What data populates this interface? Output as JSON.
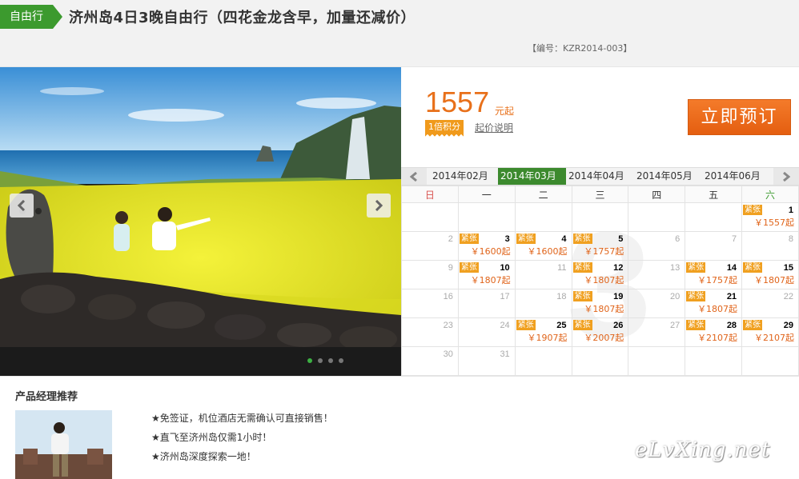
{
  "header": {
    "tag": "自由行",
    "title": "济州岛4日3晚自由行（四花金龙含早，加量还减价）",
    "code": "【编号：KZR2014-003】"
  },
  "gallery": {
    "slides": 4,
    "active_slide": 1
  },
  "pricing": {
    "price": "1557",
    "unit": "元起",
    "points_badge": "1倍积分",
    "points_link": "起价说明",
    "book_button": "立即预订"
  },
  "calendar": {
    "months": [
      "2014年02月",
      "2014年03月",
      "2014年04月",
      "2014年05月",
      "2014年06月"
    ],
    "active_month": 1,
    "weekdays": [
      "日",
      "一",
      "二",
      "三",
      "四",
      "五",
      "六"
    ],
    "weeks": [
      [
        null,
        null,
        null,
        null,
        null,
        null,
        {
          "d": "1",
          "hot": "紧张",
          "p": "￥1557起"
        }
      ],
      [
        {
          "d": "2"
        },
        {
          "d": "3",
          "hot": "紧张",
          "p": "￥1600起"
        },
        {
          "d": "4",
          "hot": "紧张",
          "p": "￥1600起"
        },
        {
          "d": "5",
          "hot": "紧张",
          "p": "￥1757起"
        },
        {
          "d": "6"
        },
        {
          "d": "7"
        },
        {
          "d": "8"
        }
      ],
      [
        {
          "d": "9"
        },
        {
          "d": "10",
          "hot": "紧张",
          "p": "￥1807起"
        },
        {
          "d": "11"
        },
        {
          "d": "12",
          "hot": "紧张",
          "p": "￥1807起"
        },
        {
          "d": "13"
        },
        {
          "d": "14",
          "hot": "紧张",
          "p": "￥1757起"
        },
        {
          "d": "15",
          "hot": "紧张",
          "p": "￥1807起"
        }
      ],
      [
        {
          "d": "16"
        },
        {
          "d": "17"
        },
        {
          "d": "18"
        },
        {
          "d": "19",
          "hot": "紧张",
          "p": "￥1807起"
        },
        {
          "d": "20"
        },
        {
          "d": "21",
          "hot": "紧张",
          "p": "￥1807起"
        },
        {
          "d": "22"
        }
      ],
      [
        {
          "d": "23"
        },
        {
          "d": "24"
        },
        {
          "d": "25",
          "hot": "紧张",
          "p": "￥1907起"
        },
        {
          "d": "26",
          "hot": "紧张",
          "p": "￥2007起"
        },
        {
          "d": "27"
        },
        {
          "d": "28",
          "hot": "紧张",
          "p": "￥2107起"
        },
        {
          "d": "29",
          "hot": "紧张",
          "p": "￥2107起"
        }
      ],
      [
        {
          "d": "30"
        },
        {
          "d": "31"
        },
        null,
        null,
        null,
        null,
        null
      ]
    ],
    "watermark": "3"
  },
  "recommend": {
    "title": "产品经理推荐",
    "items": [
      "★免签证，机位酒店无需确认可直接销售！",
      "★直飞至济州岛仅需1小时！",
      "★济州岛深度探索一地！"
    ]
  },
  "watermark_brand": "eLvXing.net",
  "colors": {
    "accent_green": "#3c9a2e",
    "price_orange": "#e8701a",
    "button_orange": "#f47b2a"
  }
}
